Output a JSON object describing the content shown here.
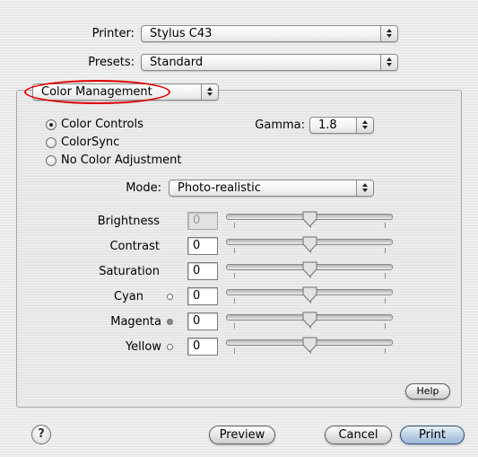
{
  "printer": {
    "label": "Printer:",
    "value": "Stylus C43"
  },
  "presets": {
    "label": "Presets:",
    "value": "Standard"
  },
  "panel": {
    "value": "Color Management"
  },
  "color_mode": {
    "options": [
      "Color Controls",
      "ColorSync",
      "No Color Adjustment"
    ],
    "selected": "Color Controls"
  },
  "gamma": {
    "label": "Gamma:",
    "value": "1.8"
  },
  "mode": {
    "label": "Mode:",
    "value": "Photo-realistic"
  },
  "adjustments": [
    {
      "label": "Brightness",
      "value": "0",
      "enabled": false,
      "slider_position": 0.5
    },
    {
      "label": "Contrast",
      "value": "0",
      "enabled": true,
      "slider_position": 0.5
    },
    {
      "label": "Saturation",
      "value": "0",
      "enabled": true,
      "slider_position": 0.5
    },
    {
      "label": "Cyan",
      "value": "0",
      "enabled": true,
      "slider_position": 0.5,
      "indicator": "open-circle"
    },
    {
      "label": "Magenta",
      "value": "0",
      "enabled": true,
      "slider_position": 0.5,
      "indicator": "filled-circle"
    },
    {
      "label": "Yellow",
      "value": "0",
      "enabled": true,
      "slider_position": 0.5,
      "indicator": "open-circle"
    }
  ],
  "buttons": {
    "help_small": "Help",
    "help_icon": "?",
    "preview": "Preview",
    "cancel": "Cancel",
    "print": "Print"
  },
  "colors": {
    "highlight_ellipse": "#e10000",
    "default_button": "#9db9d8"
  }
}
